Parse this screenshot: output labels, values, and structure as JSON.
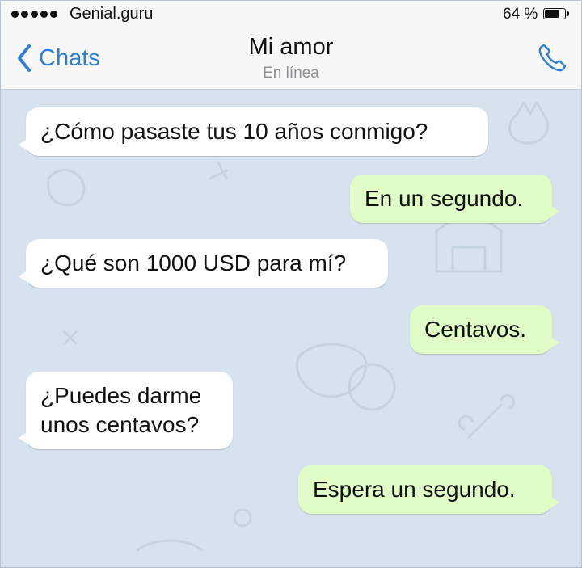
{
  "status_bar": {
    "carrier": "Genial.guru",
    "battery_percent_label": "64 %",
    "battery_level": 0.64
  },
  "nav": {
    "back_label": "Chats",
    "title": "Mi amor",
    "subtitle": "En línea",
    "icons": {
      "back": "chevron-left-icon",
      "call": "phone-icon"
    },
    "accent_color": "#2d7fd3"
  },
  "chat": {
    "incoming_color": "#ffffff",
    "outgoing_color": "#e0fcc7",
    "messages": [
      {
        "direction": "incoming",
        "text": "¿Cómo pasaste tus 10 años conmigo?"
      },
      {
        "direction": "outgoing",
        "text": "En un segundo."
      },
      {
        "direction": "incoming",
        "text": "¿Qué son 1000 USD para mí?"
      },
      {
        "direction": "outgoing",
        "text": "Centavos."
      },
      {
        "direction": "incoming",
        "text": "¿Puedes darme\nunos centavos?"
      },
      {
        "direction": "outgoing",
        "text": "Espera un segundo."
      }
    ]
  }
}
